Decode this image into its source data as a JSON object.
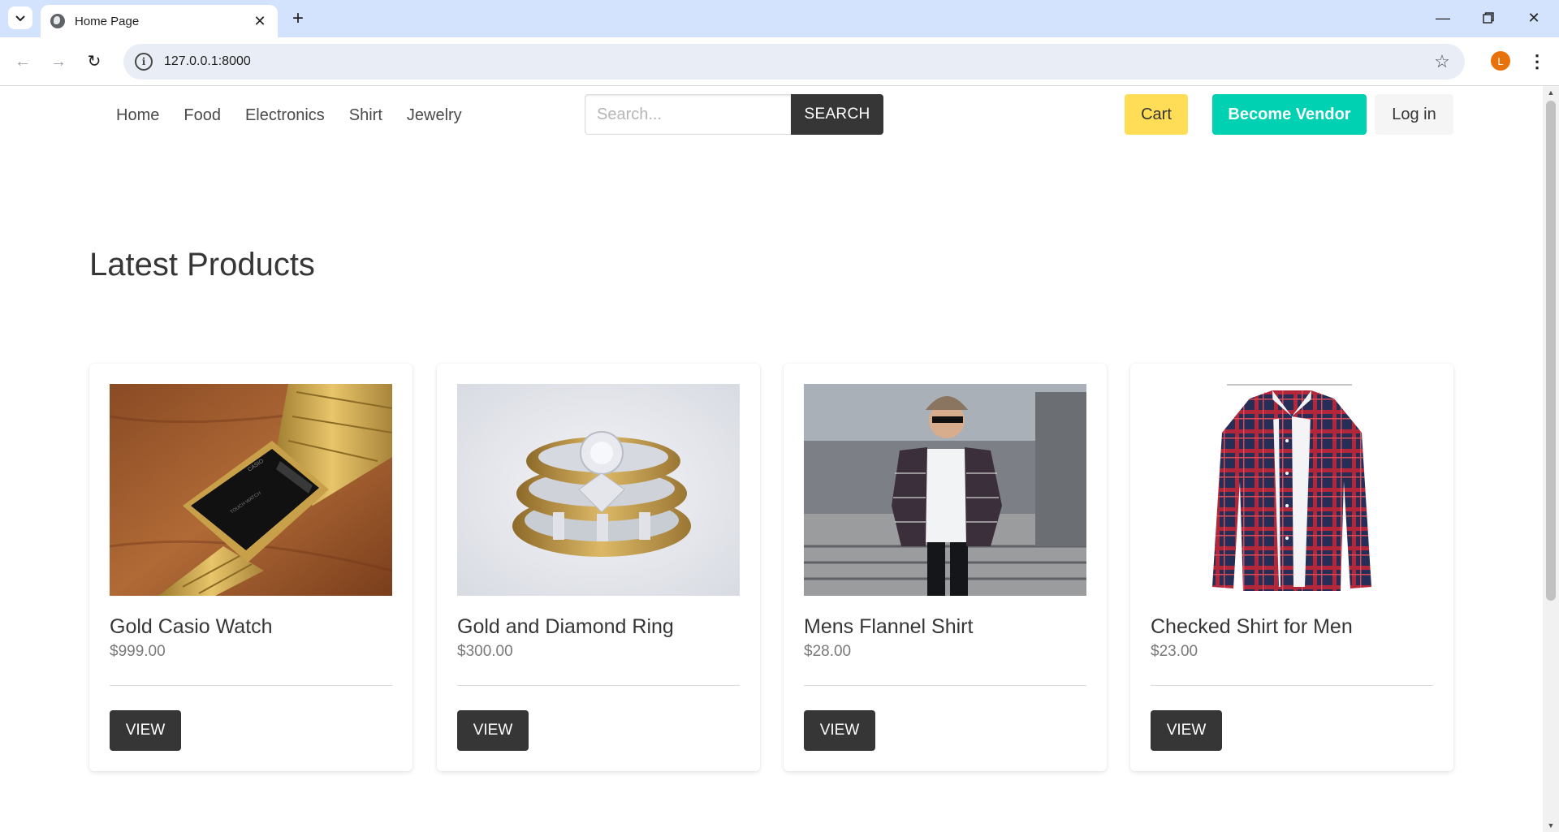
{
  "browser": {
    "tab_title": "Home Page",
    "url": "127.0.0.1:8000",
    "profile_initial": "L"
  },
  "nav": {
    "links": [
      "Home",
      "Food",
      "Electronics",
      "Shirt",
      "Jewelry"
    ],
    "search_placeholder": "Search...",
    "search_button": "SEARCH",
    "cart_button": "Cart",
    "vendor_button": "Become Vendor",
    "login_button": "Log in"
  },
  "main": {
    "title": "Latest Products",
    "products": [
      {
        "name": "Gold Casio Watch",
        "price": "$999.00",
        "button": "VIEW",
        "image": "watch-image"
      },
      {
        "name": "Gold and Diamond Ring",
        "price": "$300.00",
        "button": "VIEW",
        "image": "ring-image"
      },
      {
        "name": "Mens Flannel Shirt",
        "price": "$28.00",
        "button": "VIEW",
        "image": "man-in-flannel-photo"
      },
      {
        "name": "Checked Shirt for Men",
        "price": "$23.00",
        "button": "VIEW",
        "image": "plaid-shirt-image"
      }
    ]
  },
  "colors": {
    "cart": "#ffdd57",
    "vendor": "#00d1b2",
    "dark": "#363636",
    "browser_frame": "#d3e3fd"
  }
}
